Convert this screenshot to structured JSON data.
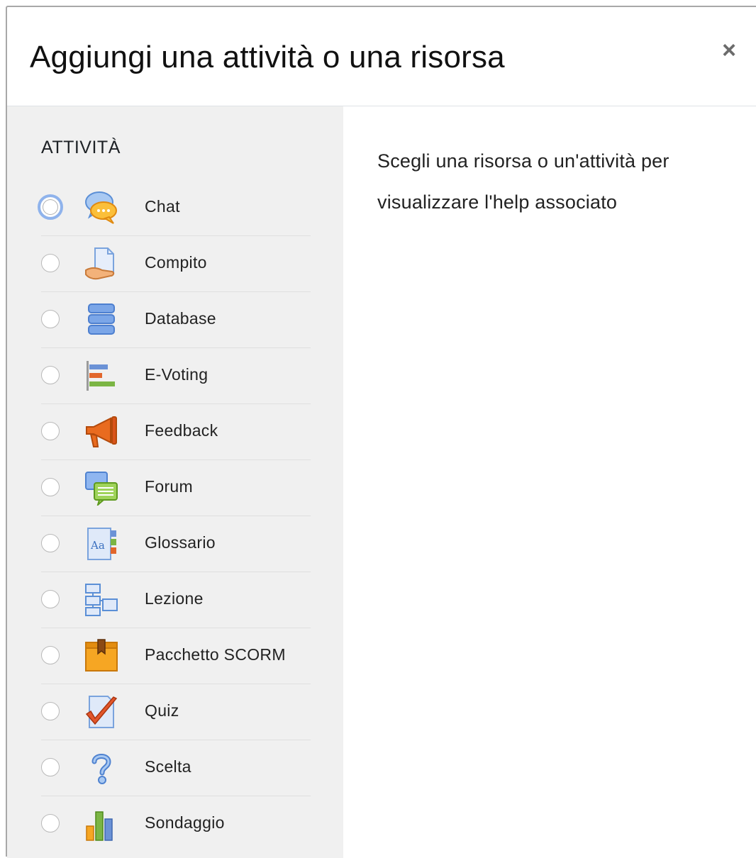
{
  "modal": {
    "title": "Aggiungi una attività o una risorsa",
    "close_glyph": "×",
    "close_icon": "close-icon"
  },
  "section": {
    "title": "ATTIVITÀ"
  },
  "options": [
    {
      "label": "Chat",
      "icon": "chat-icon",
      "focused": true
    },
    {
      "label": "Compito",
      "icon": "assignment-icon",
      "focused": false
    },
    {
      "label": "Database",
      "icon": "database-icon",
      "focused": false
    },
    {
      "label": "E-Voting",
      "icon": "evoting-icon",
      "focused": false
    },
    {
      "label": "Feedback",
      "icon": "megaphone-icon",
      "focused": false
    },
    {
      "label": "Forum",
      "icon": "forum-icon",
      "focused": false
    },
    {
      "label": "Glossario",
      "icon": "glossary-icon",
      "focused": false
    },
    {
      "label": "Lezione",
      "icon": "lesson-icon",
      "focused": false
    },
    {
      "label": "Pacchetto SCORM",
      "icon": "scorm-package-icon",
      "focused": false
    },
    {
      "label": "Quiz",
      "icon": "quiz-icon",
      "focused": false
    },
    {
      "label": "Scelta",
      "icon": "question-mark-icon",
      "focused": false
    },
    {
      "label": "Sondaggio",
      "icon": "bar-chart-icon",
      "focused": false
    }
  ],
  "help": {
    "text": "Scegli una risorsa o un'attività per visualizzare l'help associato"
  }
}
